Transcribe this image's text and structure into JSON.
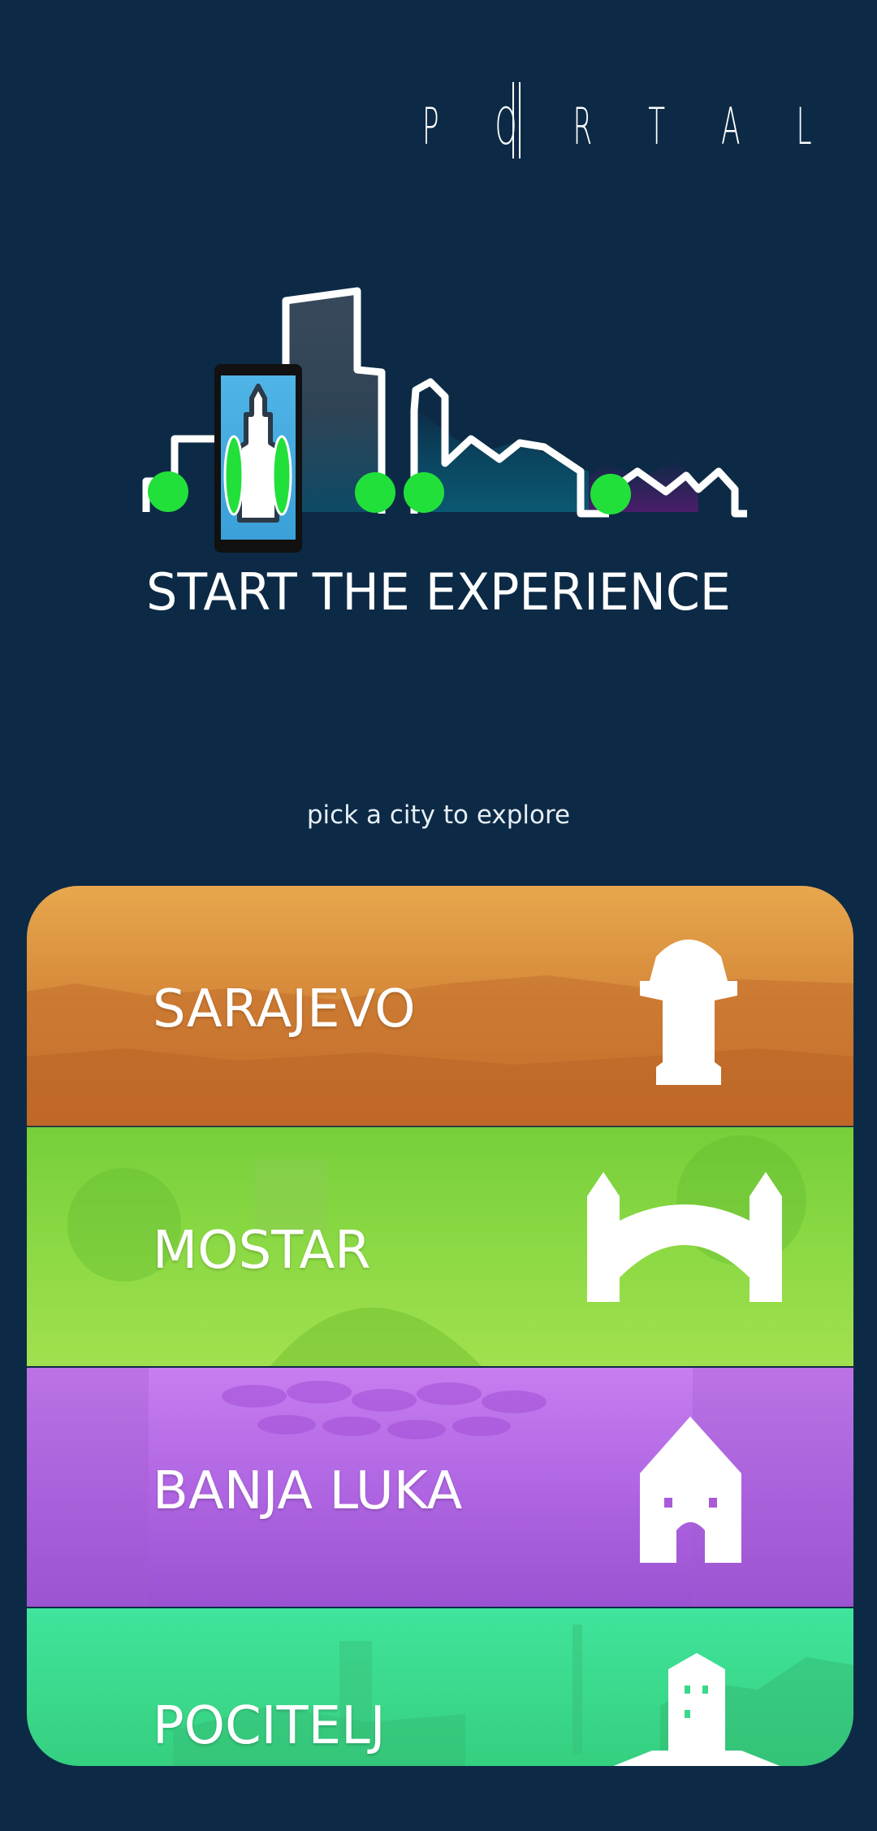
{
  "app": {
    "brand": [
      "P",
      "O",
      "R",
      "T",
      "A",
      "L"
    ]
  },
  "hero": {
    "cta_label": "START THE EXPERIENCE",
    "icon": "city-skyline-phone-icon"
  },
  "subtitle": "pick a city to explore",
  "cities": [
    {
      "name": "SARAJEVO",
      "color_top": "#e8a24a",
      "color_bottom": "#c8702a",
      "landmark_icon": "sebilj-fountain-icon"
    },
    {
      "name": "MOSTAR",
      "color_top": "#7fd23a",
      "color_bottom": "#9ee04a",
      "landmark_icon": "old-bridge-icon"
    },
    {
      "name": "BANJA LUKA",
      "color_top": "#c77ef0",
      "color_bottom": "#9b4fd0",
      "landmark_icon": "castle-tower-icon"
    },
    {
      "name": "POCITELJ",
      "color_top": "#3ee39a",
      "color_bottom": "#34d47f",
      "landmark_icon": "fortress-tower-icon"
    }
  ]
}
